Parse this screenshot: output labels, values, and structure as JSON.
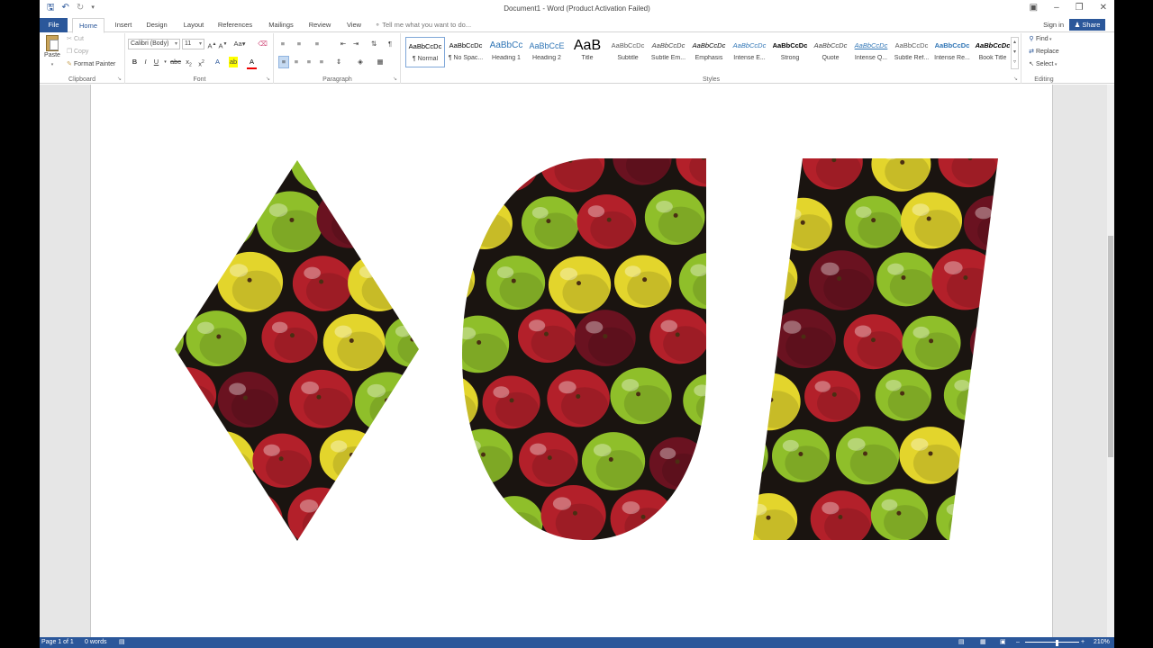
{
  "window": {
    "title": "Document1 - Word (Product Activation Failed)"
  },
  "tabs": [
    "File",
    "Home",
    "Insert",
    "Design",
    "Layout",
    "References",
    "Mailings",
    "Review",
    "View"
  ],
  "tell_me": "Tell me what you want to do...",
  "account": {
    "sign_in": "Sign in",
    "share": "Share"
  },
  "clipboard": {
    "paste": "Paste",
    "cut": "Cut",
    "copy": "Copy",
    "format_painter": "Format Painter",
    "label": "Clipboard"
  },
  "font": {
    "name": "Calibri (Body)",
    "size": "11",
    "label": "Font"
  },
  "paragraph": {
    "label": "Paragraph"
  },
  "styles": {
    "label": "Styles",
    "items": [
      {
        "preview": "AaBbCcDc",
        "name": "¶ Normal"
      },
      {
        "preview": "AaBbCcDc",
        "name": "¶ No Spac..."
      },
      {
        "preview": "AaBbCc",
        "name": "Heading 1"
      },
      {
        "preview": "AaBbCcE",
        "name": "Heading 2"
      },
      {
        "preview": "AaB",
        "name": "Title"
      },
      {
        "preview": "AaBbCcDc",
        "name": "Subtitle"
      },
      {
        "preview": "AaBbCcDc",
        "name": "Subtle Em..."
      },
      {
        "preview": "AaBbCcDc",
        "name": "Emphasis"
      },
      {
        "preview": "AaBbCcDc",
        "name": "Intense E..."
      },
      {
        "preview": "AaBbCcDc",
        "name": "Strong"
      },
      {
        "preview": "AaBbCcDc",
        "name": "Quote"
      },
      {
        "preview": "AaBbCcDc",
        "name": "Intense Q..."
      },
      {
        "preview": "AaBbCcDc",
        "name": "Subtle Ref..."
      },
      {
        "preview": "AaBbCcDc",
        "name": "Intense Re..."
      },
      {
        "preview": "AaBbCcDc",
        "name": "Book Title"
      }
    ]
  },
  "editing": {
    "find": "Find",
    "replace": "Replace",
    "select": "Select",
    "label": "Editing"
  },
  "status": {
    "page": "Page 1 of 1",
    "words": "0 words",
    "zoom": "210%"
  },
  "colors": {
    "accent": "#2b579a",
    "apple_red": "#b3202a",
    "apple_green": "#8fbf2a",
    "apple_yellow": "#e3d52c",
    "apple_dark": "#6a1220",
    "background_dark": "#1a1410"
  }
}
